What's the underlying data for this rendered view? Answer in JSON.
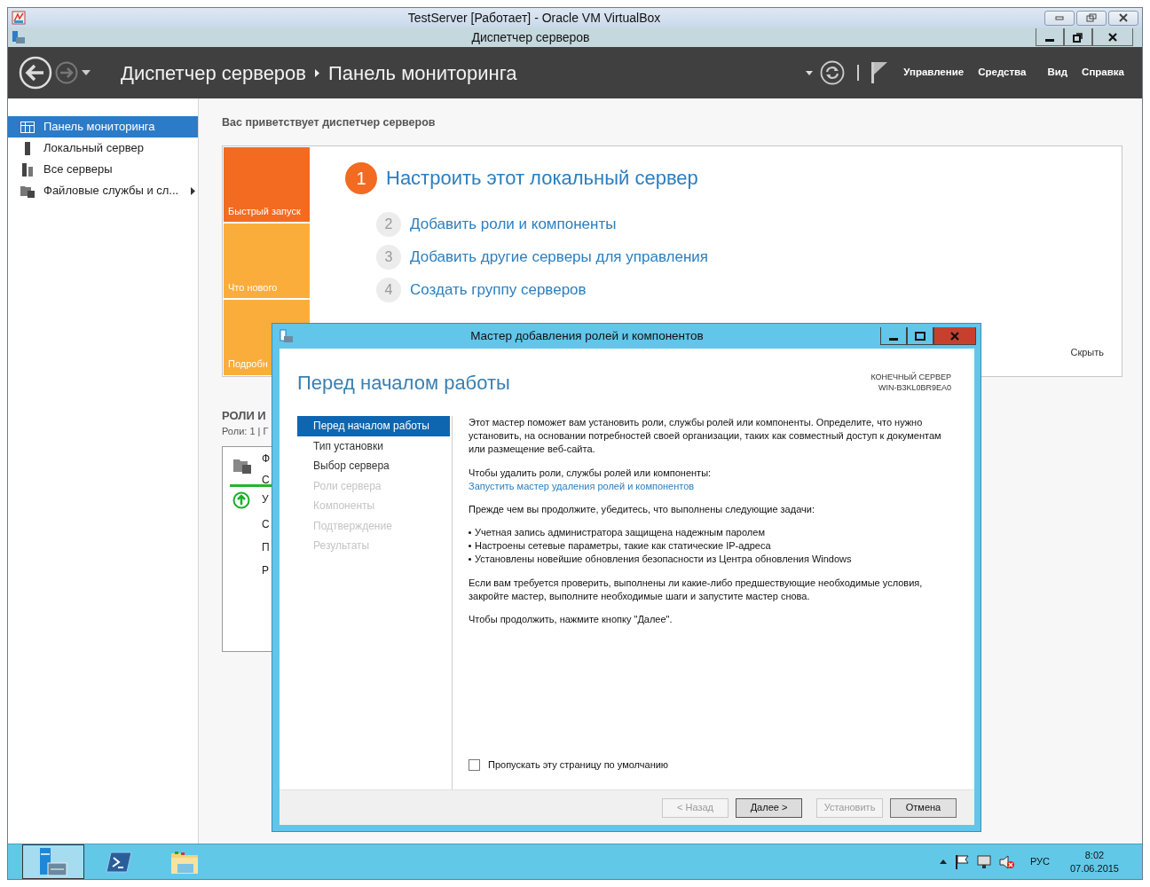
{
  "vm_window": {
    "title": "TestServer [Работает] - Oracle VM VirtualBox"
  },
  "app_window": {
    "title": "Диспетчер серверов"
  },
  "header": {
    "breadcrumb": [
      "Диспетчер серверов",
      "Панель мониторинга"
    ],
    "menu": [
      "Управление",
      "Средства",
      "Вид",
      "Справка"
    ]
  },
  "sidebar": {
    "items": [
      {
        "label": "Панель мониторинга",
        "kind": "dashboard",
        "selected": true,
        "expandable": false
      },
      {
        "label": "Локальный сервер",
        "kind": "server",
        "selected": false,
        "expandable": false
      },
      {
        "label": "Все серверы",
        "kind": "servers",
        "selected": false,
        "expandable": false
      },
      {
        "label": "Файловые службы и сл...",
        "kind": "file-services",
        "selected": false,
        "expandable": true
      }
    ]
  },
  "welcome": "Вас приветствует диспетчер серверов",
  "quick_start": {
    "tiles": [
      {
        "label": "Быстрый запуск",
        "color": "#f26b21"
      },
      {
        "label": "Что нового",
        "color": "#fbad3b"
      },
      {
        "label": "Подробн",
        "color": "#fbad3b"
      }
    ],
    "steps": [
      {
        "number": "1",
        "label": "Настроить этот локальный сервер",
        "kind": "primary"
      },
      {
        "number": "2",
        "label": "Добавить роли и компоненты",
        "kind": "secondary"
      },
      {
        "number": "3",
        "label": "Добавить другие серверы для управления",
        "kind": "secondary"
      },
      {
        "number": "4",
        "label": "Создать группу серверов",
        "kind": "secondary"
      }
    ],
    "hide": "Скрыть"
  },
  "roles": {
    "title": "РОЛИ И",
    "subtitle": "Роли: 1 | Г",
    "tile_lines": [
      "Ф",
      "С",
      "У",
      "С",
      "П",
      "Р"
    ]
  },
  "wizard": {
    "title": "Мастер добавления ролей и компонентов",
    "heading": "Перед началом работы",
    "target_label": "КОНЕЧНЫЙ СЕРВЕР",
    "target_server": "WIN-B3KL0BR9EA0",
    "steps": [
      {
        "label": "Перед началом работы",
        "selected": true,
        "disabled": false
      },
      {
        "label": "Тип установки",
        "selected": false,
        "disabled": false
      },
      {
        "label": "Выбор сервера",
        "selected": false,
        "disabled": false
      },
      {
        "label": "Роли сервера",
        "selected": false,
        "disabled": true
      },
      {
        "label": "Компоненты",
        "selected": false,
        "disabled": true
      },
      {
        "label": "Подтверждение",
        "selected": false,
        "disabled": true
      },
      {
        "label": "Результаты",
        "selected": false,
        "disabled": true
      }
    ],
    "content": [
      {
        "kind": "paragraph",
        "text": "Этот мастер поможет вам установить роли, службы ролей или компоненты. Определите, что нужно установить, на основании потребностей своей организации, таких как совместный доступ к документам или размещение веб-сайта."
      },
      {
        "kind": "paragraph",
        "text": "Чтобы удалить роли, службы ролей или компоненты:",
        "link": "Запустить мастер удаления ролей и компонентов"
      },
      {
        "kind": "paragraph",
        "text": "Прежде чем вы продолжите, убедитесь, что выполнены следующие задачи:"
      },
      {
        "kind": "bullets",
        "items": [
          "Учетная запись администратора защищена надежным паролем",
          "Настроены сетевые параметры, такие как статические IP-адреса",
          "Установлены новейшие обновления безопасности из Центра обновления Windows"
        ]
      },
      {
        "kind": "paragraph",
        "text": "Если вам требуется проверить, выполнены ли какие-либо предшествующие необходимые условия, закройте мастер, выполните необходимые шаги и запустите мастер снова."
      },
      {
        "kind": "paragraph",
        "text": "Чтобы продолжить, нажмите кнопку \"Далее\"."
      }
    ],
    "skip_checkbox": {
      "label": "Пропускать эту страницу по умолчанию",
      "checked": false
    },
    "buttons": [
      {
        "label": "< Назад",
        "disabled": true,
        "default": false
      },
      {
        "label": "Далее >",
        "disabled": false,
        "default": true
      },
      {
        "label": "Установить",
        "disabled": true,
        "default": false
      },
      {
        "label": "Отмена",
        "disabled": false,
        "default": false
      }
    ]
  },
  "taskbar": {
    "apps": [
      {
        "kind": "server-manager",
        "selected": true
      },
      {
        "kind": "powershell",
        "selected": false
      },
      {
        "kind": "explorer",
        "selected": false
      }
    ],
    "language": "РУС",
    "time": "8:02",
    "date": "07.06.2015"
  }
}
